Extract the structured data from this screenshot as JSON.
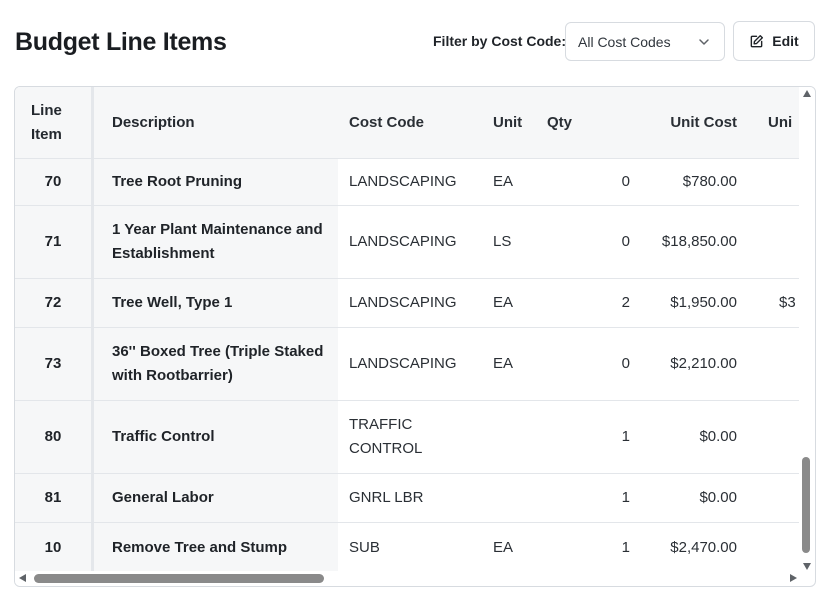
{
  "header": {
    "title": "Budget Line Items",
    "filter_label": "Filter by Cost Code:",
    "filter_value": "All Cost Codes",
    "edit_label": "Edit"
  },
  "table": {
    "columns": {
      "line_item": "Line Item",
      "description": "Description",
      "cost_code": "Cost Code",
      "unit": "Unit",
      "qty": "Qty",
      "unit_cost": "Unit Cost",
      "unit_total": "Uni"
    },
    "rows": [
      {
        "line": "70",
        "description": "Tree Root Pruning",
        "cost_code": "LANDSCAPING",
        "unit": "EA",
        "qty": "0",
        "unit_cost": "$780.00",
        "unit_total": ""
      },
      {
        "line": "71",
        "description": "1 Year Plant Maintenance and Establishment",
        "cost_code": "LANDSCAPING",
        "unit": "LS",
        "qty": "0",
        "unit_cost": "$18,850.00",
        "unit_total": ""
      },
      {
        "line": "72",
        "description": "Tree Well, Type 1",
        "cost_code": "LANDSCAPING",
        "unit": "EA",
        "qty": "2",
        "unit_cost": "$1,950.00",
        "unit_total": "$3"
      },
      {
        "line": "73",
        "description": "36'' Boxed Tree (Triple Staked with Rootbarrier)",
        "cost_code": "LANDSCAPING",
        "unit": "EA",
        "qty": "0",
        "unit_cost": "$2,210.00",
        "unit_total": ""
      },
      {
        "line": "80",
        "description": "Traffic Control",
        "cost_code": "TRAFFIC CONTROL",
        "unit": "",
        "qty": "1",
        "unit_cost": "$0.00",
        "unit_total": ""
      },
      {
        "line": "81",
        "description": "General Labor",
        "cost_code": "GNRL LBR",
        "unit": "",
        "qty": "1",
        "unit_cost": "$0.00",
        "unit_total": ""
      },
      {
        "line": "10",
        "description": "Remove Tree and Stump",
        "cost_code": "SUB",
        "unit": "EA",
        "qty": "1",
        "unit_cost": "$2,470.00",
        "unit_total": ""
      }
    ]
  },
  "icons": {
    "select_chevron": "chevron-down-icon",
    "edit": "edit-icon"
  },
  "colors": {
    "sticky_column_bg": "#f6f7f8",
    "border": "#d7dbe0",
    "scrollbar_thumb": "#8a8a8a"
  }
}
